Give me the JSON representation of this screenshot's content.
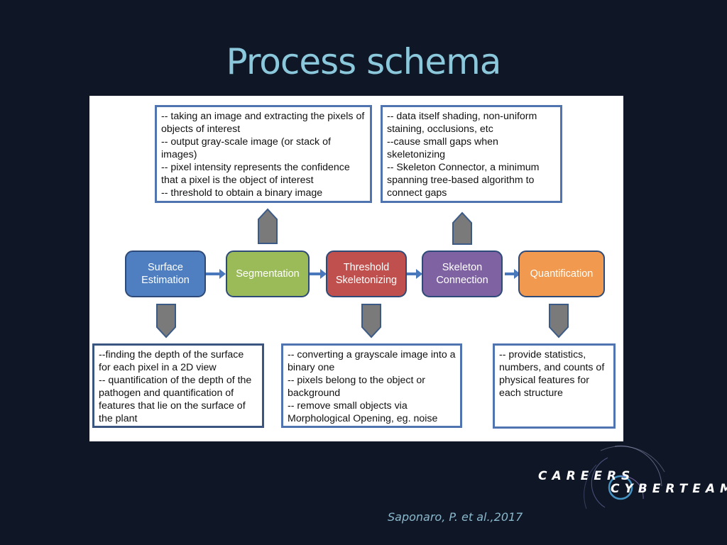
{
  "slide": {
    "title": "Process schema",
    "credit": "Saponaro, P. et al.,2017"
  },
  "logo": {
    "line1": "CAREERS",
    "line2": "CYBERTEAM"
  },
  "stages": [
    {
      "label": "Surface\nEstimation",
      "color": "#4f7fc0"
    },
    {
      "label": "Segmentation",
      "color": "#9bbb59"
    },
    {
      "label": "Threshold\nSkeletonizing",
      "color": "#c0504d"
    },
    {
      "label": "Skeleton\nConnection",
      "color": "#7f62a2"
    },
    {
      "label": "Quantification",
      "color": "#f0994f"
    }
  ],
  "notes": {
    "segmentation": "-- taking an image and extracting the pixels of objects of interest\n-- output gray-scale image (or stack of images)\n-- pixel intensity represents the confidence that a pixel is the object of interest\n-- threshold to obtain a binary image",
    "skeleton_connection": "-- data itself shading, non-uniform staining, occlusions, etc\n--cause small gaps when skeletonizing\n-- Skeleton Connector, a minimum spanning tree-based algorithm to connect gaps",
    "surface_estimation": "--finding the depth of the surface for each pixel in a 2D view\n-- quantification of the depth of the pathogen and quantification of features that lie on the surface of the plant",
    "threshold_skeletonizing": "-- converting a grayscale image into a binary one\n-- pixels belong to the object or background\n-- remove small objects via Morphological Opening, eg. noise",
    "quantification": "-- provide statistics, numbers, and counts of physical features for each structure"
  },
  "colors": {
    "background": "#0f1726",
    "title": "#8cc8dc",
    "note_border": "#4f74b0",
    "connector_arrow": "#7a7a7a"
  }
}
